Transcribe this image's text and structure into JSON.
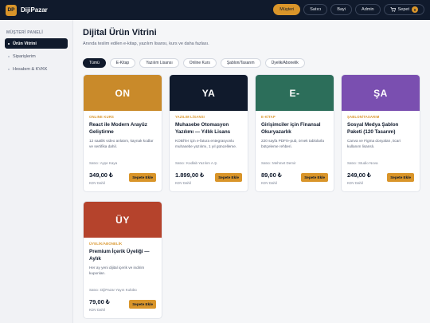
{
  "header": {
    "logo_text": "DP",
    "brand": "DijiPazar",
    "nav": [
      "Müşteri",
      "Satıcı",
      "Bayi",
      "Admin"
    ],
    "active_nav": "Müşteri",
    "cart_label": "Sepet",
    "cart_count": "0"
  },
  "sidebar": {
    "title": "MÜŞTERİ PANELİ",
    "items": [
      {
        "label": "Ürün Vitrini",
        "active": true
      },
      {
        "label": "Siparişlerim",
        "active": false
      },
      {
        "label": "Hesabım & KVKK",
        "active": false
      }
    ]
  },
  "main": {
    "title": "Dijital Ürün Vitrini",
    "subtitle": "Anında teslim edilen e-kitap, yazılım lisansı, kurs ve daha fazlası.",
    "filters": [
      "Tümü",
      "E-Kitap",
      "Yazılım Lisansı",
      "Online Kurs",
      "Şablon/Tasarım",
      "Üyelik/Abonelik"
    ],
    "active_filter": "Tümü"
  },
  "products": [
    {
      "hero_text": "ON",
      "hero_color": "#c98a2a",
      "category": "ONLINE KURS",
      "title": "React ile Modern Arayüz Geliştirme",
      "description": "12 saatlik video anlatım, kaynak kodlar ve sertifika dahil.",
      "seller": "Satıcı: Ayşe Kaya",
      "price": "349,00 ₺",
      "vat": "KDV Dahil",
      "button": "Sepete Ekle"
    },
    {
      "hero_text": "YA",
      "hero_color": "#101a2c",
      "category": "YAZILIM LİSANSI",
      "title": "Muhasebe Otomasyon Yazılımı — Yıllık Lisans",
      "description": "KOBİ'ler için e-fatura entegrasyonlu muhasebe yazılımı, 1 yıl güncelleme.",
      "seller": "Satıcı: Kodlab Yazılım A.Ş.",
      "price": "1.899,00 ₺",
      "vat": "KDV Dahil",
      "button": "Sepete Ekle"
    },
    {
      "hero_text": "E-",
      "hero_color": "#2c6e5a",
      "category": "E-KİTAP",
      "title": "Girişimciler için Finansal Okuryazarlık",
      "description": "220 sayfa PDF/e-pub, örnek tablolarla bütçeleme rehberi.",
      "seller": "Satıcı: Mehmet Demir",
      "price": "89,00 ₺",
      "vat": "KDV Dahil",
      "button": "Sepete Ekle"
    },
    {
      "hero_text": "ŞA",
      "hero_color": "#7a4fb0",
      "category": "ŞABLON/TASARIM",
      "title": "Sosyal Medya Şablon Paketi (120 Tasarım)",
      "description": "Canva ve Figma dosyaları, ticari kullanım lisanslı.",
      "seller": "Satıcı: Studio Nova",
      "price": "249,00 ₺",
      "vat": "KDV Dahil",
      "button": "Sepete Ekle"
    },
    {
      "hero_text": "ÜY",
      "hero_color": "#b5432c",
      "category": "ÜYELİK/ABONELİK",
      "title": "Premium İçerik Üyeliği — Aylık",
      "description": "Her ay yeni dijital içerik ve indirim kuponları.",
      "seller": "Satıcı: DijiPazar Yayın Kulübü",
      "price": "79,00 ₺",
      "vat": "KDV Dahil",
      "button": "Sepete Ekle"
    }
  ]
}
